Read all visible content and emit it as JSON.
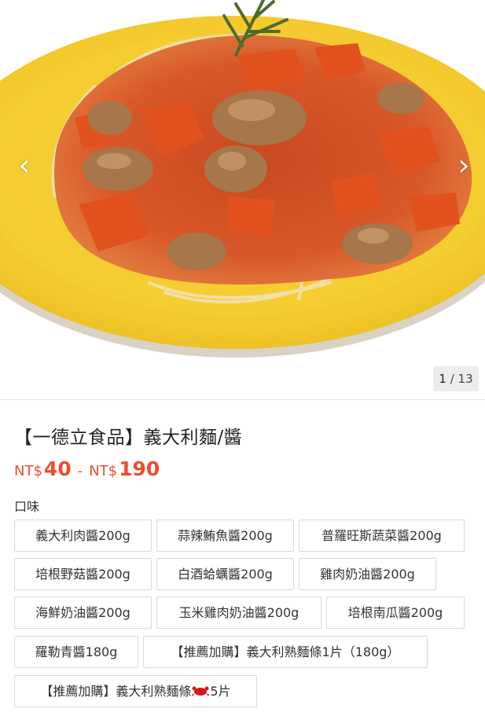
{
  "gallery": {
    "image_alt": "義大利麵",
    "counter_current": "1",
    "counter_sep": "/",
    "counter_total": "13",
    "prev_icon": "chevron-left-icon",
    "next_icon": "chevron-right-icon"
  },
  "product": {
    "title": "【一德立食品】義大利麵/醬",
    "price_currency": "NT$",
    "price_min": "40",
    "price_sep": "-",
    "price_max": "190",
    "accent_color": "#ee4d2d"
  },
  "options": {
    "label": "口味",
    "items": [
      "義大利肉醬200g",
      "蒜辣鮪魚醬200g",
      "普羅旺斯蔬菜醬200g",
      "培根野菇醬200g",
      "白酒蛤蠣醬200g",
      "雞肉奶油醬200g",
      "海鮮奶油醬200g",
      "玉米雞肉奶油醬200g",
      "培根南瓜醬200g",
      "羅勒青醬180g",
      "【推薦加購】義大利熟麵條1片（180g）"
    ],
    "last_item_prefix": "【推薦加購】義大利熟麵條",
    "last_item_suffix": "5片",
    "last_item_icon": "crab-emoji-icon"
  }
}
